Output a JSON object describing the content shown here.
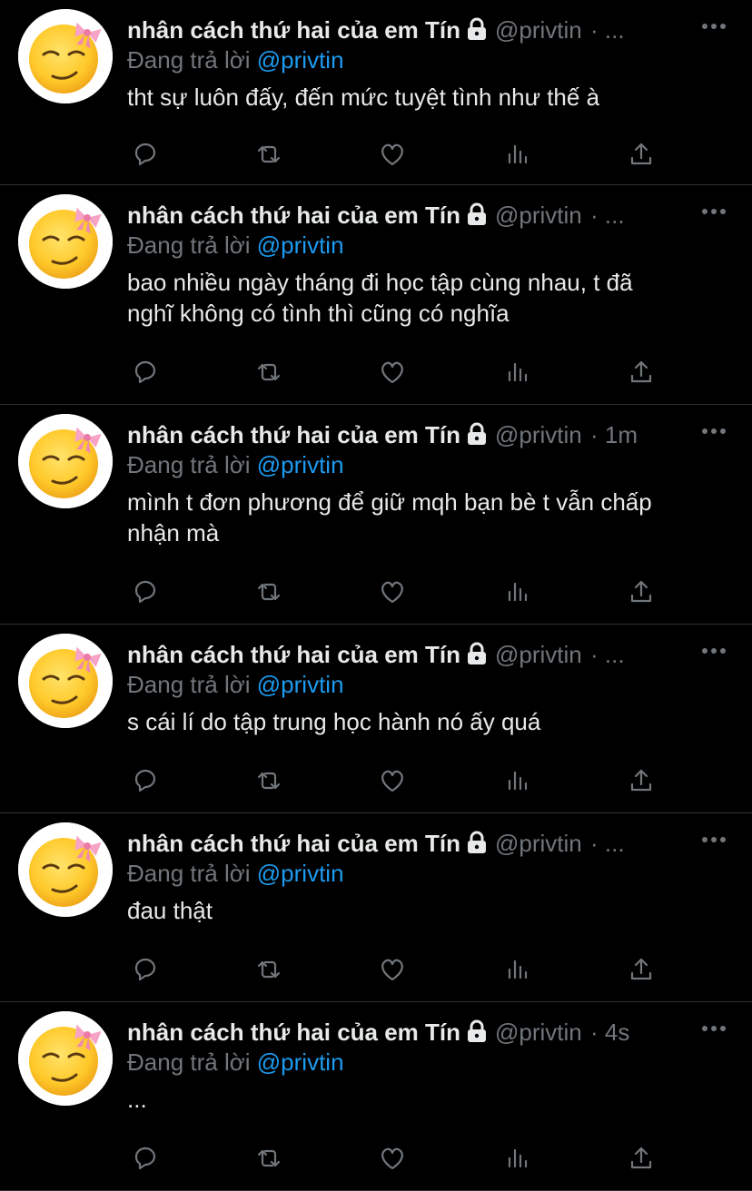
{
  "tweets": [
    {
      "name": "nhân cách thứ hai của em Tín",
      "handle": "@privtin",
      "time": "· ...",
      "reply_prefix": "Đang trả lời ",
      "reply_to": "@privtin",
      "text": "tht sự luôn đấy, đến mức tuyệt tình như thế à"
    },
    {
      "name": "nhân cách thứ hai của em Tín",
      "handle": "@privtin",
      "time": "· ...",
      "reply_prefix": "Đang trả lời ",
      "reply_to": "@privtin",
      "text": "bao nhiều ngày tháng đi học tập cùng nhau, t đã\nnghĩ không có tình thì cũng có nghĩa"
    },
    {
      "name": "nhân cách thứ hai của em Tín",
      "handle": "@privtin",
      "time": "· 1m",
      "reply_prefix": "Đang trả lời ",
      "reply_to": "@privtin",
      "text": "mình t đơn phương để giữ mqh bạn bè t vẫn chấp\nnhận mà"
    },
    {
      "name": "nhân cách thứ hai của em Tín",
      "handle": "@privtin",
      "time": "· ...",
      "reply_prefix": "Đang trả lời ",
      "reply_to": "@privtin",
      "text": "s cái lí do tập trung học hành nó ấy quá"
    },
    {
      "name": "nhân cách thứ hai của em Tín",
      "handle": "@privtin",
      "time": "· ...",
      "reply_prefix": "Đang trả lời ",
      "reply_to": "@privtin",
      "text": "đau thật"
    },
    {
      "name": "nhân cách thứ hai của em Tín",
      "handle": "@privtin",
      "time": "· 4s",
      "reply_prefix": "Đang trả lời ",
      "reply_to": "@privtin",
      "text": "..."
    }
  ],
  "icons": {
    "avatar": "smirking-face-with-bow-emoji",
    "lock": "lock-icon",
    "more": "more-dots-icon",
    "reply": "reply-icon",
    "retweet": "retweet-icon",
    "like": "heart-icon",
    "views": "views-icon",
    "share": "share-icon"
  },
  "colors": {
    "background": "#000000",
    "text": "#e7e9ea",
    "muted": "#71767b",
    "link": "#1d9bf0",
    "divider": "#2f3336"
  }
}
